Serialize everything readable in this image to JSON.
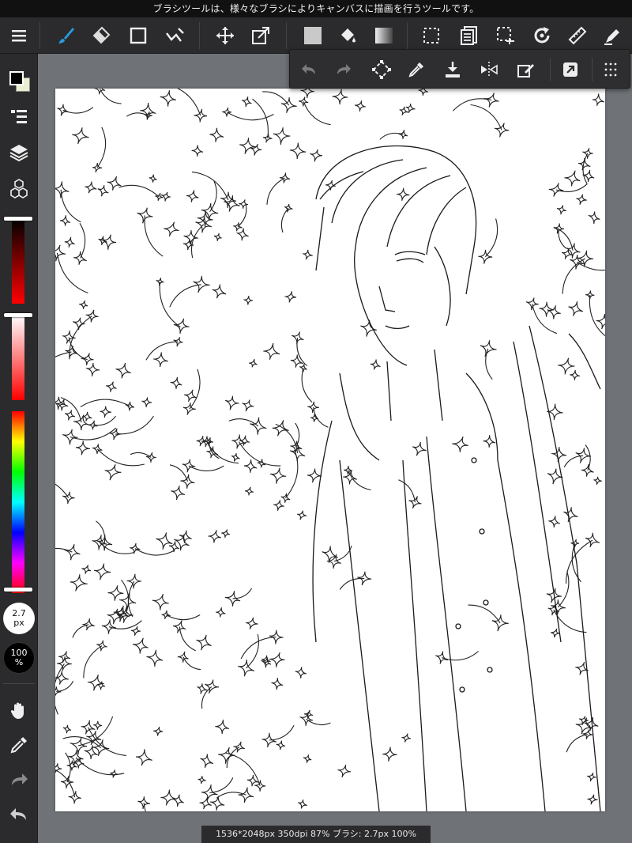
{
  "hint": "ブラシツールは、様々なブラシによりキャンバスに描画を行うツールです。",
  "brush_size": {
    "value": "2.7",
    "unit": "px"
  },
  "opacity": {
    "value": "100",
    "unit": "%"
  },
  "info_bar": "1536*2048px 350dpi 87% ブラシ: 2.7px 100%",
  "colors": {
    "primary": "#000000",
    "secondary": "#e9efd0",
    "accent": "#1f8fd6",
    "toolbar_bg": "#2b2b2d",
    "workspace_bg": "#6f7378"
  },
  "toolbar": {
    "items": [
      "menu-icon",
      "brush-icon",
      "eraser-icon",
      "rect-icon",
      "snap-icon",
      "move-icon",
      "transform-icon",
      "fill-color-icon",
      "bucket-icon",
      "gradient-icon",
      "selection-icon",
      "layer-list-icon",
      "select-area-icon",
      "rotate-icon",
      "ruler-icon",
      "pen-icon"
    ]
  },
  "subtoolbar": {
    "items": [
      "undo-icon",
      "redo-icon",
      "lasso-transform-icon",
      "eyedropper-icon",
      "import-icon",
      "flip-icon",
      "clear-icon",
      "share-icon",
      "more-icon"
    ]
  },
  "sidebar": {
    "items": [
      "color-swatch",
      "layer-properties-icon",
      "layers-icon",
      "materials-icon",
      "hand-icon",
      "eyedropper-icon",
      "redo-icon",
      "undo-icon"
    ]
  },
  "sliders": {
    "dark_red_level": 1.0,
    "light_red_level": 1.0,
    "hue_level": 0.0
  }
}
